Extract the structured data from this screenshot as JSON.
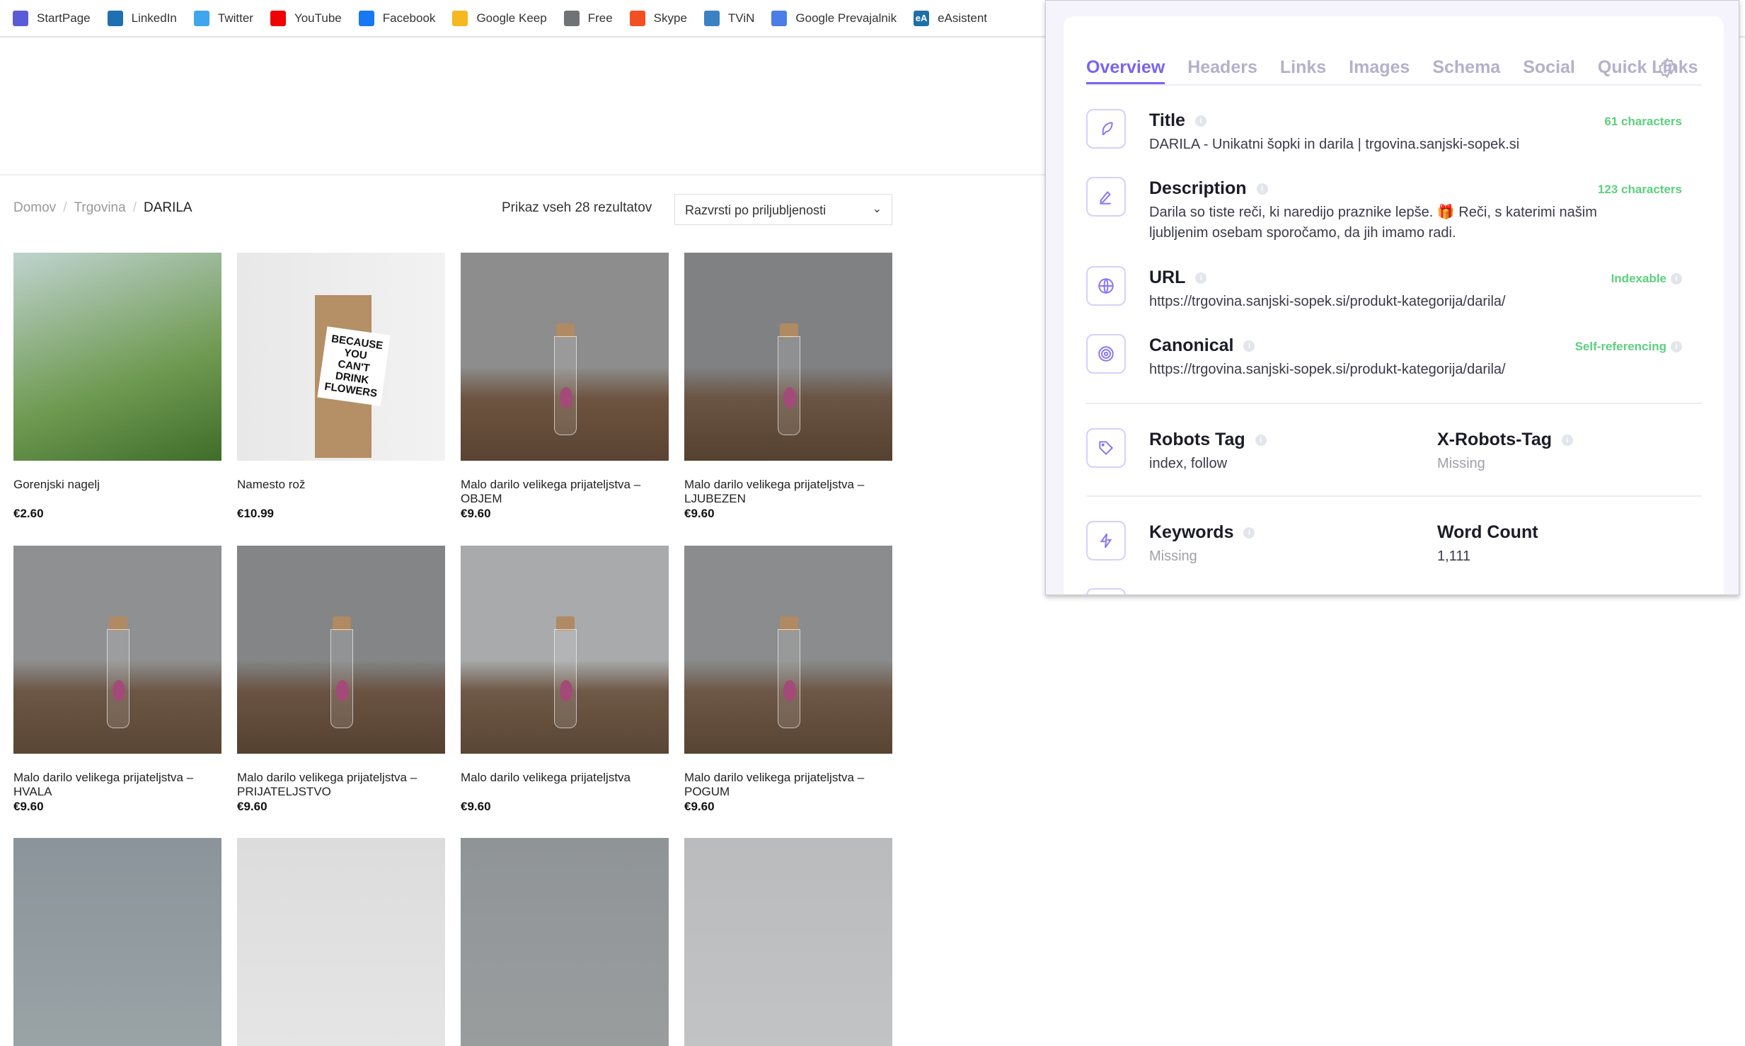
{
  "bookmarks": [
    {
      "label": "StartPage",
      "icon": "startpage-icon",
      "color": "#5b5bd6"
    },
    {
      "label": "LinkedIn",
      "icon": "linkedin-icon",
      "color": "#1f6fb2"
    },
    {
      "label": "Twitter",
      "icon": "twitter-icon",
      "color": "#3ea6ec"
    },
    {
      "label": "YouTube",
      "icon": "youtube-icon",
      "color": "#f00000"
    },
    {
      "label": "Facebook",
      "icon": "facebook-icon",
      "color": "#1877f2"
    },
    {
      "label": "Google Keep",
      "icon": "google-keep-icon",
      "color": "#f5b821"
    },
    {
      "label": "Free",
      "icon": "folder-icon",
      "color": "#6f7378"
    },
    {
      "label": "Skype",
      "icon": "microsoft-icon",
      "color": "#f25022"
    },
    {
      "label": "TViN",
      "icon": "tvin-icon",
      "color": "#3b82c4"
    },
    {
      "label": "Google Prevajalnik",
      "icon": "google-translate-icon",
      "color": "#4a7de8"
    },
    {
      "label": "eAsistent",
      "icon": "easistent-icon",
      "color": "#1f6fa8",
      "glyph": "eA"
    }
  ],
  "breadcrumb": [
    "Domov",
    "Trgovina",
    "DARILA"
  ],
  "results_text": "Prikaz vseh 28 rezultatov",
  "sort": {
    "selected": "Razvrsti po priljubljenosti"
  },
  "products": [
    {
      "name": "Gorenjski nagelj",
      "price": "€2.60"
    },
    {
      "name": "Namesto rož",
      "price": "€10.99",
      "image_text": "BECAUSE YOU CAN'T DRINK FLOWERS"
    },
    {
      "name": "Malo darilo velikega prijateljstva – OBJEM",
      "price": "€9.60"
    },
    {
      "name": "Malo darilo velikega prijateljstva – LJUBEZEN",
      "price": "€9.60"
    },
    {
      "name": "Malo darilo velikega prijateljstva – HVALA",
      "price": "€9.60"
    },
    {
      "name": "Malo darilo velikega prijateljstva – PRIJATELJSTVO",
      "price": "€9.60"
    },
    {
      "name": "Malo darilo velikega prijateljstva",
      "price": "€9.60"
    },
    {
      "name": "Malo darilo velikega prijateljstva – POGUM",
      "price": "€9.60"
    }
  ],
  "seo_panel": {
    "accent": "#7a63f0",
    "tabs": [
      "Overview",
      "Headers",
      "Links",
      "Images",
      "Schema",
      "Social",
      "Quick Links"
    ],
    "active_tab": "Overview",
    "title": {
      "label": "Title",
      "value": "DARILA - Unikatni šopki in darila | trgovina.sanjski-sopek.si",
      "badge": "61 characters"
    },
    "description": {
      "label": "Description",
      "value": "Darila so tiste reči, ki naredijo praznike lepše. 🎁 Reči, s katerimi našim ljubljenim osebam sporočamo, da jih imamo radi.",
      "badge": "123 characters"
    },
    "url": {
      "label": "URL",
      "value": "https://trgovina.sanjski-sopek.si/produkt-kategorija/darila/",
      "badge": "Indexable"
    },
    "canonical": {
      "label": "Canonical",
      "value": "https://trgovina.sanjski-sopek.si/produkt-kategorija/darila/",
      "badge": "Self-referencing"
    },
    "robots": {
      "label": "Robots Tag",
      "value": "index, follow"
    },
    "x_robots": {
      "label": "X-Robots-Tag",
      "value": "Missing"
    },
    "keywords": {
      "label": "Keywords",
      "value": "Missing"
    },
    "word_count": {
      "label": "Word Count",
      "value": "1,111"
    }
  }
}
